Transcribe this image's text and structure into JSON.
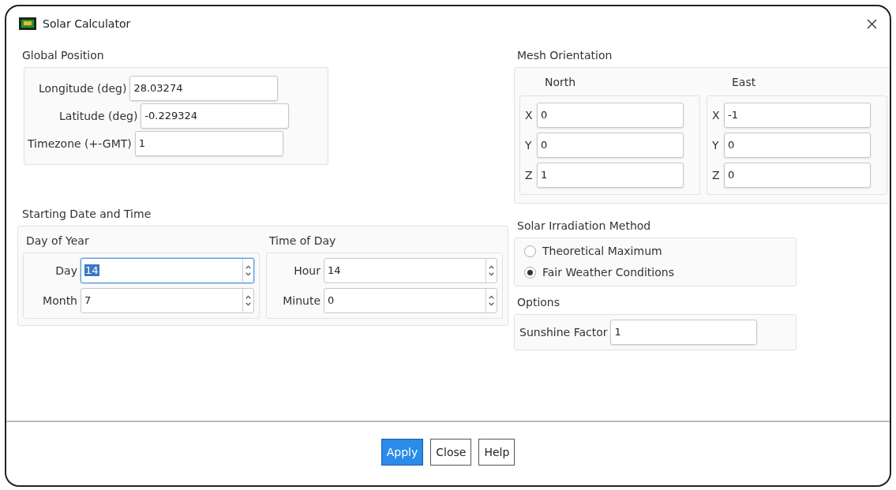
{
  "window": {
    "title": "Solar Calculator"
  },
  "global_position": {
    "title": "Global Position",
    "fields": [
      {
        "label": "Longitude (deg)",
        "value": "28.03274"
      },
      {
        "label": "Latitude (deg)",
        "value": "-0.229324"
      },
      {
        "label": "Timezone (+-GMT)",
        "value": "1"
      }
    ]
  },
  "mesh_orientation": {
    "title": "Mesh Orientation",
    "groups": [
      {
        "title": "North",
        "fields": [
          {
            "label": "X",
            "value": "0"
          },
          {
            "label": "Y",
            "value": "0"
          },
          {
            "label": "Z",
            "value": "1"
          }
        ]
      },
      {
        "title": "East",
        "fields": [
          {
            "label": "X",
            "value": "-1"
          },
          {
            "label": "Y",
            "value": "0"
          },
          {
            "label": "Z",
            "value": "0"
          }
        ]
      }
    ]
  },
  "starting_date_time": {
    "title": "Starting Date and Time",
    "groups": [
      {
        "title": "Day of Year",
        "fields": [
          {
            "label": "Day",
            "value": "14",
            "focused": true
          },
          {
            "label": "Month",
            "value": "7",
            "focused": false
          }
        ]
      },
      {
        "title": "Time of Day",
        "fields": [
          {
            "label": "Hour",
            "value": "14",
            "focused": false
          },
          {
            "label": "Minute",
            "value": "0",
            "focused": false
          }
        ]
      }
    ]
  },
  "solar_irradiation_method": {
    "title": "Solar Irradiation Method",
    "options": [
      {
        "label": "Theoretical Maximum",
        "selected": false
      },
      {
        "label": "Fair Weather Conditions",
        "selected": true
      }
    ]
  },
  "options": {
    "title": "Options",
    "fields": [
      {
        "label": "Sunshine Factor",
        "value": "1"
      }
    ]
  },
  "buttons": [
    {
      "label": "Apply",
      "primary": true
    },
    {
      "label": "Close",
      "primary": false
    },
    {
      "label": "Help",
      "primary": false
    }
  ]
}
